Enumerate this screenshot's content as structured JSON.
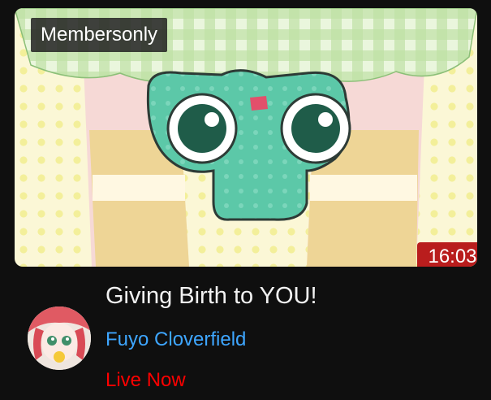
{
  "video": {
    "badge_text": "Membersonly",
    "duration": "16:03",
    "title": "Giving Birth to YOU!",
    "channel_name": "Fuyo Cloverfield",
    "live_status": "Live Now"
  },
  "colors": {
    "background": "#0f0f0f",
    "title": "#f1f1f1",
    "channel_link": "#3ea6ff",
    "live": "#ff0000",
    "duration_badge": "#b91d1d"
  }
}
